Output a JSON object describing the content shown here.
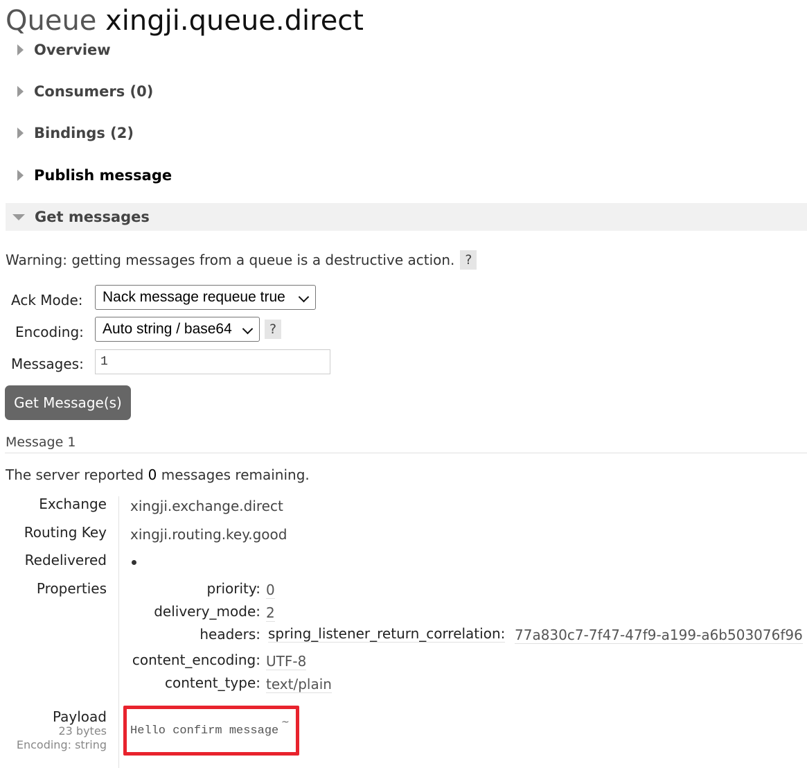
{
  "header": {
    "prefix": "Queue",
    "name": "xingji.queue.direct"
  },
  "sections": [
    {
      "label": "Overview"
    },
    {
      "label": "Consumers (0)"
    },
    {
      "label": "Bindings (2)"
    },
    {
      "label": "Publish message"
    },
    {
      "label": "Get messages"
    }
  ],
  "get": {
    "warning": "Warning: getting messages from a queue is a destructive action.",
    "help": "?",
    "ack_label": "Ack Mode:",
    "ack_value": "Nack message requeue true",
    "encoding_label": "Encoding:",
    "encoding_value": "Auto string / base64",
    "messages_label": "Messages:",
    "messages_value": "1",
    "button": "Get Message(s)"
  },
  "message": {
    "heading": "Message 1",
    "remaining_pre": "The server reported",
    "remaining_count": "0",
    "remaining_post": "messages remaining.",
    "exchange_label": "Exchange",
    "exchange": "xingji.exchange.direct",
    "routing_label": "Routing Key",
    "routing_key": "xingji.routing.key.good",
    "redelivered_label": "Redelivered",
    "redelivered": true,
    "properties_label": "Properties",
    "properties": {
      "priority_key": "priority:",
      "priority": "0",
      "delivery_mode_key": "delivery_mode:",
      "delivery_mode": "2",
      "headers_key": "headers:",
      "header_name": "spring_listener_return_correlation:",
      "header_value": "77a830c7-7f47-47f9-a199-a6b503076f96",
      "content_encoding_key": "content_encoding:",
      "content_encoding": "UTF-8",
      "content_type_key": "content_type:",
      "content_type": "text/plain"
    },
    "payload_label": "Payload",
    "payload_size": "23 bytes",
    "payload_encoding": "Encoding: string",
    "payload": "Hello confirm message",
    "payload_marker": "~"
  },
  "colors": {
    "highlight": "#e8232d",
    "button": "#666666",
    "section_open_bg": "#f1f1f1"
  }
}
